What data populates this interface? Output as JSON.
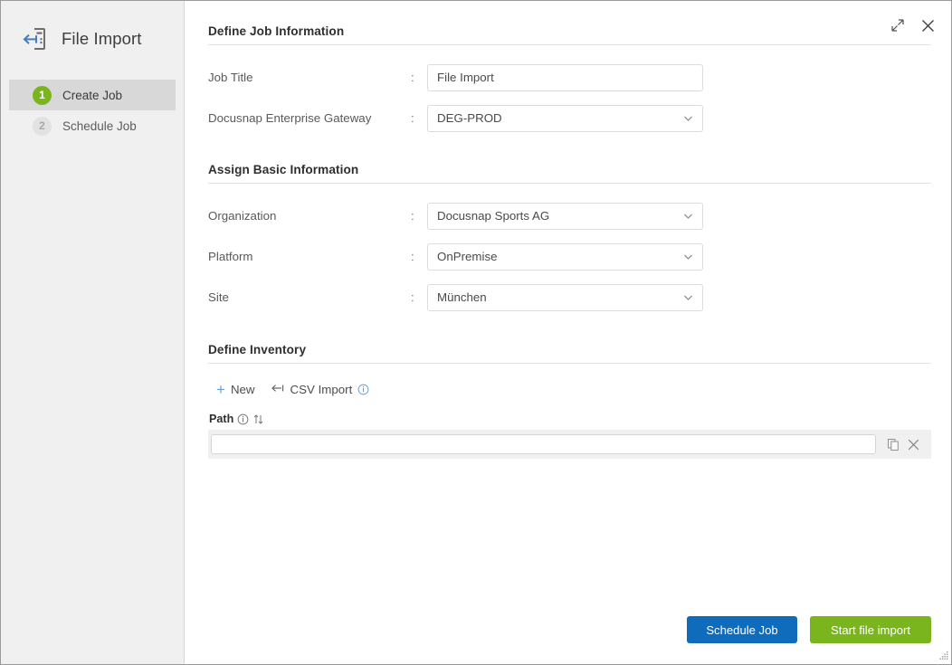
{
  "app": {
    "title": "File Import",
    "icon": "file-import-icon"
  },
  "window_controls": [
    {
      "name": "expand-icon",
      "label": "Expand"
    },
    {
      "name": "close-icon",
      "label": "Close"
    }
  ],
  "sidebar": {
    "steps": [
      {
        "number": "1",
        "label": "Create Job",
        "active": true
      },
      {
        "number": "2",
        "label": "Schedule Job",
        "active": false
      }
    ]
  },
  "sections": {
    "job_information": {
      "title": "Define Job Information",
      "fields": [
        {
          "label": "Job Title",
          "separator": ":",
          "value": "File Import",
          "type": "text"
        },
        {
          "label": "Docusnap Enterprise Gateway",
          "separator": ":",
          "value": "DEG-PROD",
          "type": "select"
        }
      ]
    },
    "basic_information": {
      "title": "Assign Basic Information",
      "fields": [
        {
          "label": "Organization",
          "separator": ":",
          "value": "Docusnap Sports AG",
          "type": "select"
        },
        {
          "label": "Platform",
          "separator": ":",
          "value": "OnPremise",
          "type": "select"
        },
        {
          "label": "Site",
          "separator": ":",
          "value": "München",
          "type": "select"
        }
      ]
    },
    "inventory": {
      "title": "Define Inventory",
      "toolbar": [
        {
          "name": "new-button",
          "label": "New",
          "icon": "plus-icon"
        },
        {
          "name": "csv-import-button",
          "label": "CSV Import",
          "icon": "import-arrow-icon",
          "info": "info-icon"
        }
      ],
      "grid": {
        "column_header": "Path",
        "header_icons": [
          "info-icon",
          "sort-icon"
        ],
        "rows": [
          {
            "path": "",
            "actions": [
              "copy-icon",
              "delete-icon"
            ]
          }
        ]
      }
    }
  },
  "footer": {
    "schedule_job_label": "Schedule Job",
    "start_import_label": "Start file import"
  },
  "colors": {
    "accent_blue": "#0f6cbd",
    "accent_green": "#7ab51d",
    "sidebar_bg": "#f0f0f0",
    "icon_blue": "#3e7fbf"
  }
}
